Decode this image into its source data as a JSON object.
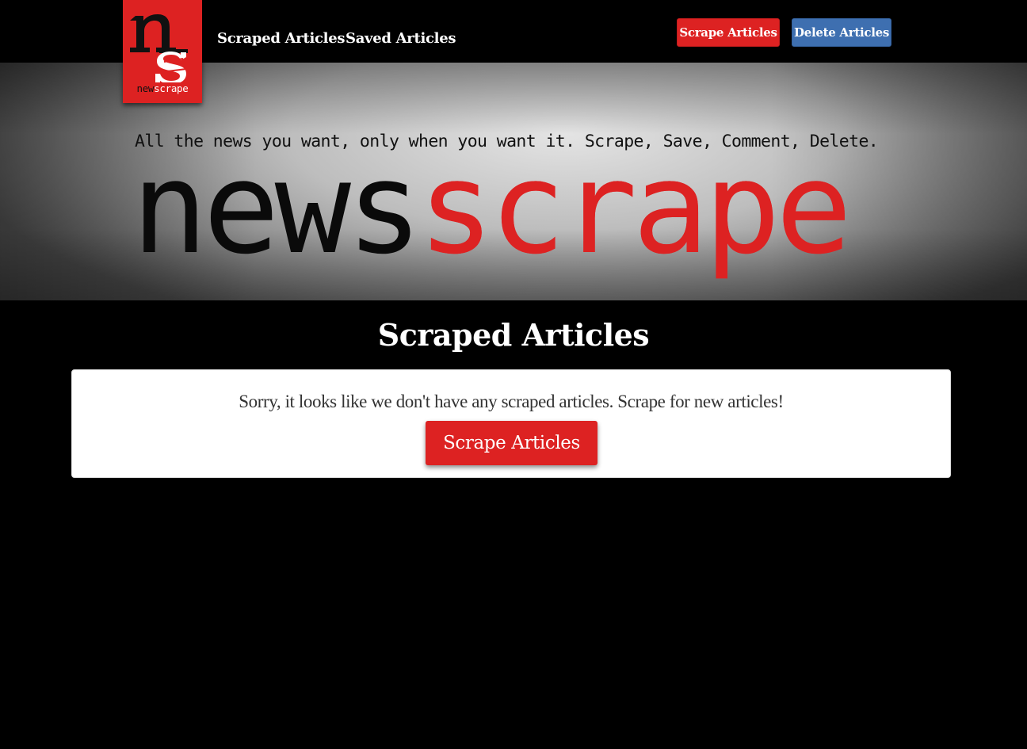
{
  "brand": {
    "logo_letters": "ns",
    "logo_word_part1": "new",
    "logo_word_part2": "scrape",
    "colors": {
      "red": "#dd2222",
      "blue": "#3e6fb0",
      "background": "#000000",
      "panel": "#ffffff"
    }
  },
  "nav": {
    "links": [
      {
        "label": "Scraped Articles"
      },
      {
        "label": "Saved Articles"
      }
    ],
    "scrape_button": "Scrape Articles",
    "delete_button": "Delete Articles"
  },
  "banner": {
    "tagline": "All the news you want, only when you want it. Scrape, Save, Comment, Delete.",
    "title_part1": "news",
    "title_part2": "scrape"
  },
  "main": {
    "heading": "Scraped Articles",
    "empty_message": "Sorry, it looks like we don't have any scraped articles. Scrape for new articles!",
    "scrape_button": "Scrape Articles"
  }
}
